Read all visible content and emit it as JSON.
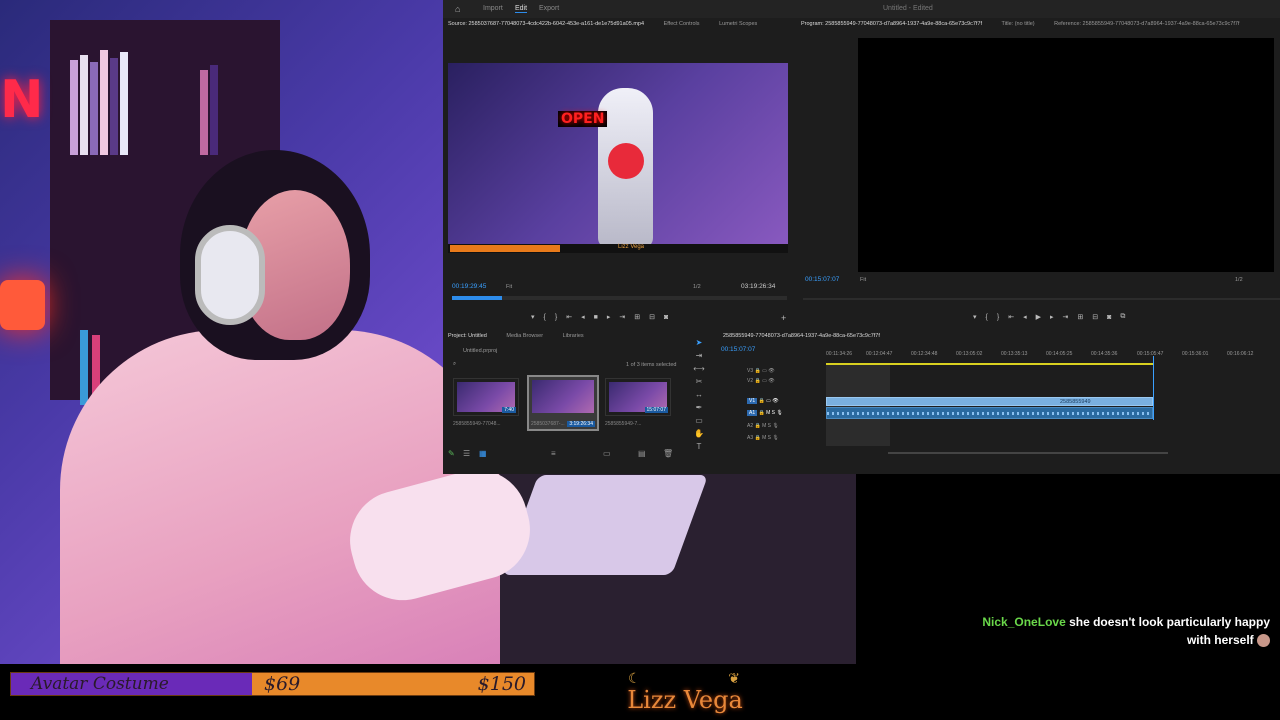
{
  "premiere": {
    "tabs": [
      "Import",
      "Edit",
      "Export"
    ],
    "active_tab": "Edit",
    "doc_title": "Untitled - Edited",
    "source_panel": {
      "tabs": [
        "Source: 2585037687-77048073-4cdc422b-6042-453e-a161-de1e75d91a05.mp4",
        "Effect Controls",
        "Lumetri Scopes"
      ],
      "timecode_in": "00:19:29:45",
      "fit": "Fit",
      "ratio": "1/2",
      "duration": "03:19:26:34",
      "overlay_open_sign": "OPEN",
      "overlay_name": "Lizz Vega"
    },
    "program_panel": {
      "tabs": [
        "Program: 2585855949-77048073-d7a8964-1937-4a9e-88ca-65e73c9c7f7f",
        "Title: (no title)",
        "Reference: 2585855949-77048073-d7a8964-1937-4a9e-88ca-65e73c9c7f7f"
      ],
      "timecode": "00:15:07:07",
      "fit": "Fit",
      "ratio": "1/2"
    },
    "project_panel": {
      "tabs": [
        "Project: Untitled",
        "Media Browser",
        "Libraries"
      ],
      "project_file": "Untitled.prproj",
      "selection_status": "1 of 3 items selected",
      "items": [
        {
          "name": "2585855949-77048...",
          "duration": "7:40"
        },
        {
          "name": "2585037687-...",
          "duration": "3:19:26:34"
        },
        {
          "name": "2585855949-7...",
          "duration": "15:07:07"
        }
      ]
    },
    "timeline": {
      "sequence_name": "2585855949-77048073-d7a8964-1937-4a9e-88ca-65e73c9c7f7f",
      "timecode": "00:15:07:07",
      "ruler": [
        "00:11:34:26",
        "00:12:04:47",
        "00:12:34:48",
        "00:13:05:02",
        "00:13:35:13",
        "00:14:05:25",
        "00:14:35:36",
        "00:15:05:47",
        "00:15:36:01",
        "00:16:06:12"
      ],
      "tracks": [
        "V3",
        "V2",
        "V1",
        "A1",
        "A2",
        "A3"
      ],
      "clip_label": "2585855949"
    }
  },
  "overlays": {
    "goal": {
      "label": "Avatar Costume",
      "current": "$69",
      "target": "$150",
      "progress": 0.46
    },
    "brand": "Lizz Vega",
    "chat": {
      "user": "Nick_OneLove",
      "message": "she doesn't look particularly happy with herself"
    }
  },
  "colors": {
    "accent_blue": "#2d8ceb",
    "goal_purple": "#6a2ab8",
    "goal_orange": "#e8892a",
    "chat_user_green": "#6ad84a"
  }
}
